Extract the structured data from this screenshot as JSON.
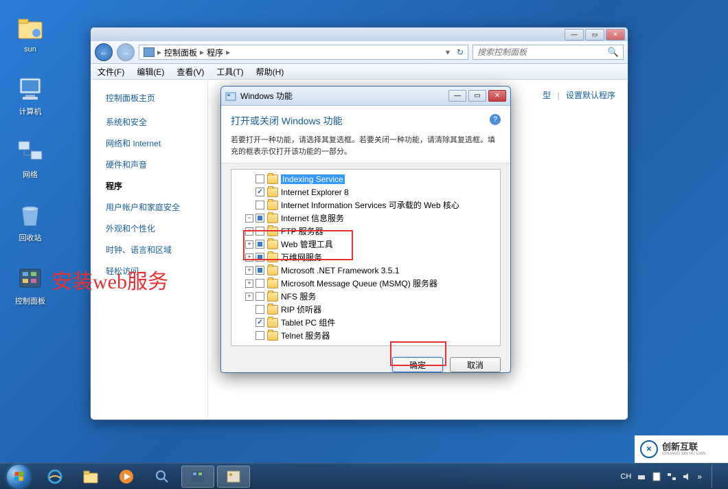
{
  "desktop": {
    "icons": [
      "sun",
      "计算机",
      "网络",
      "回收站",
      "控制面板"
    ]
  },
  "annotation": "安装web服务",
  "cp_window": {
    "breadcrumb": {
      "root": "控制面板",
      "sub": "程序"
    },
    "search_placeholder": "搜索控制面板",
    "menu": [
      "文件(F)",
      "编辑(E)",
      "查看(V)",
      "工具(T)",
      "帮助(H)"
    ],
    "sidebar": {
      "title": "控制面板主页",
      "items": [
        "系统和安全",
        "网络和 Internet",
        "硬件和声音",
        "程序",
        "用户帐户和家庭安全",
        "外观和个性化",
        "时钟、语言和区域",
        "轻松访问"
      ],
      "active_index": 3
    },
    "right_links": {
      "a": "型",
      "b": "设置默认程序"
    }
  },
  "dialog": {
    "title": "Windows 功能",
    "heading": "打开或关闭 Windows 功能",
    "description": "若要打开一种功能，请选择其复选框。若要关闭一种功能，请清除其复选框。填充的框表示仅打开该功能的一部分。",
    "tree": [
      {
        "indent": 0,
        "expander": "none",
        "check": "none",
        "label": "Indexing Service",
        "selected": true
      },
      {
        "indent": 0,
        "expander": "none",
        "check": "checked",
        "label": "Internet Explorer 8"
      },
      {
        "indent": 0,
        "expander": "none",
        "check": "none",
        "label": "Internet Information Services 可承载的 Web 核心"
      },
      {
        "indent": 0,
        "expander": "minus",
        "check": "partial",
        "label": "Internet 信息服务"
      },
      {
        "indent": 1,
        "expander": "plus",
        "check": "none",
        "label": "FTP 服务器"
      },
      {
        "indent": 1,
        "expander": "plus",
        "check": "partial",
        "label": "Web 管理工具"
      },
      {
        "indent": 1,
        "expander": "plus",
        "check": "partial",
        "label": "万维网服务"
      },
      {
        "indent": 0,
        "expander": "plus",
        "check": "partial",
        "label": "Microsoft .NET Framework 3.5.1"
      },
      {
        "indent": 0,
        "expander": "plus",
        "check": "none",
        "label": "Microsoft Message Queue (MSMQ) 服务器"
      },
      {
        "indent": 0,
        "expander": "plus",
        "check": "none",
        "label": "NFS 服务"
      },
      {
        "indent": 0,
        "expander": "none",
        "check": "none",
        "label": "RIP 侦听器"
      },
      {
        "indent": 0,
        "expander": "none",
        "check": "checked",
        "label": "Tablet PC 组件"
      },
      {
        "indent": 0,
        "expander": "none",
        "check": "none",
        "label": "Telnet 服务器"
      }
    ],
    "buttons": {
      "ok": "确定",
      "cancel": "取消"
    }
  },
  "taskbar": {
    "lang": "CH"
  },
  "logo": {
    "cn": "创新互联",
    "en": "CHUANG XIN HU LIAN"
  }
}
